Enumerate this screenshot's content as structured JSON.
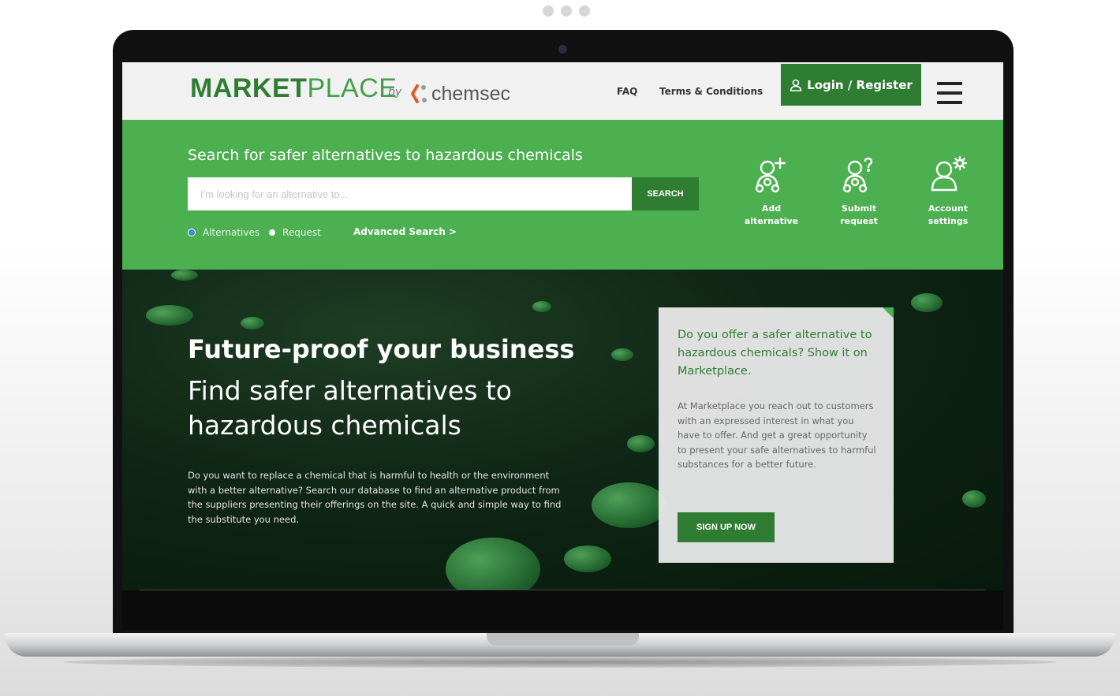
{
  "header": {
    "logo_bold": "MARKET",
    "logo_thin": "PLACE",
    "logo_by": "by",
    "brand": "chemsec",
    "nav": [
      {
        "label": "FAQ"
      },
      {
        "label": "Terms & Conditions"
      }
    ],
    "login_label": "Login / Register"
  },
  "search": {
    "title": "Search for safer alternatives to hazardous chemicals",
    "placeholder": "I'm looking for an alternative to...",
    "button_label": "SEARCH",
    "options": [
      {
        "label": "Alternatives"
      },
      {
        "label": "Request"
      }
    ],
    "advanced_label": "Advanced Search >"
  },
  "quick_actions": [
    {
      "line1": "Add",
      "line2": "alternative",
      "icon": "add-user-icon"
    },
    {
      "line1": "Submit",
      "line2": "request",
      "icon": "question-user-icon"
    },
    {
      "line1": "Account",
      "line2": "settings",
      "icon": "settings-user-icon"
    }
  ],
  "hero": {
    "title": "Future-proof your business",
    "subtitle": "Find safer alternatives to hazardous chemicals",
    "body": "Do you want to replace a chemical that is harmful to health or the environment with a better alternative? Search our database to find an alternative product from the suppliers presenting their offerings on the site. A quick and simple way to find the substitute you need."
  },
  "card": {
    "heading": "Do you offer a safer alternative to hazardous chemicals? Show it on Marketplace.",
    "body": "At Marketplace you reach out to customers with an expressed interest in what you have to offer. And get a great opportunity to present your safe alternatives to harmful substances for a better future.",
    "button_label": "SIGN UP NOW"
  },
  "colors": {
    "accent": "#4caf50",
    "accent_dark": "#2e7d32"
  }
}
